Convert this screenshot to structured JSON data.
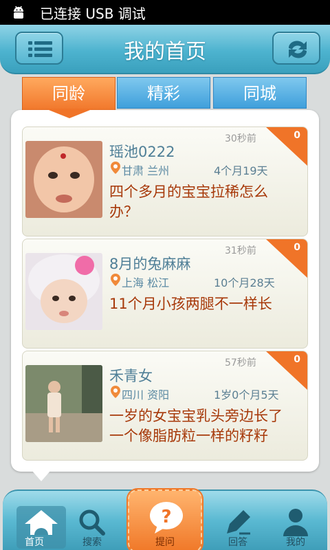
{
  "status_bar": {
    "text": "已连接 USB 调试"
  },
  "header": {
    "title": "我的首页"
  },
  "tabs": [
    {
      "label": "同龄",
      "active": true
    },
    {
      "label": "精彩",
      "active": false
    },
    {
      "label": "同城",
      "active": false
    }
  ],
  "posts": [
    {
      "name": "瑶池0222",
      "time": "30秒前",
      "count": "0",
      "location": "甘肃 兰州",
      "age": "4个月19天",
      "question": "四个多月的宝宝拉稀怎么办？"
    },
    {
      "name": "8月的兔麻麻",
      "time": "31秒前",
      "count": "0",
      "location": "上海 松江",
      "age": "10个月28天",
      "question": "11个月小孩两腿不一样长"
    },
    {
      "name": "禾青女",
      "time": "57秒前",
      "count": "0",
      "location": "四川 资阳",
      "age": "1岁0个月5天",
      "question": "一岁的女宝宝乳头旁边长了一个像脂肪粒一样的籽籽"
    }
  ],
  "bottom_nav": {
    "home": "首页",
    "search": "搜索",
    "ask": "提问",
    "answer": "回答",
    "mine": "我的"
  },
  "colors": {
    "accent_orange": "#f07428",
    "header_blue": "#4db3cf",
    "question_text": "#a7390a",
    "name_text": "#4f7f97"
  },
  "icons": [
    "android-icon",
    "menu-icon",
    "refresh-icon",
    "location-pin-icon",
    "home-icon",
    "search-icon",
    "question-icon",
    "pen-icon",
    "user-icon"
  ]
}
